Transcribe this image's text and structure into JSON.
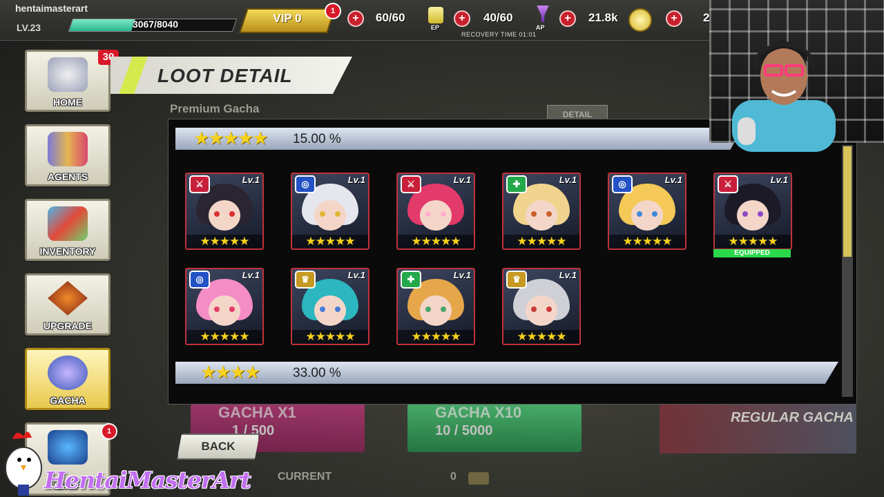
{
  "player": {
    "username": "hentaimasterart",
    "level": "LV.23",
    "exp": "3067/8040",
    "exp_fraction": 0.38
  },
  "vip": {
    "label": "VIP 0",
    "badge": "1"
  },
  "resources": {
    "ep": {
      "value": "60/60",
      "label": "EP"
    },
    "ap": {
      "value": "40/60",
      "label": "AP"
    },
    "gold": {
      "value": "21.8k"
    },
    "extra": {
      "value": "2"
    },
    "recovery": "RECOVERY TIME 01:01"
  },
  "sidebar": {
    "items": [
      {
        "label": "HOME",
        "badge": "30"
      },
      {
        "label": "AGENTS"
      },
      {
        "label": "INVENTORY"
      },
      {
        "label": "UPGRADE"
      },
      {
        "label": "GACHA"
      },
      {
        "label": "SHOP",
        "badge": "1"
      }
    ]
  },
  "page": {
    "title": "LOOT DETAIL",
    "subtitle": "Premium Gacha",
    "detail_button": "DETAIL",
    "back_button": "BACK",
    "current_label": "CURRENT",
    "current_value": "0",
    "gacha_x1": {
      "title": "GACHA X1",
      "cost": "1 / 500"
    },
    "gacha_x10": {
      "title": "GACHA X10",
      "cost": "10 / 5000"
    },
    "regular_gacha": "REGULAR GACHA"
  },
  "loot": {
    "tiers": [
      {
        "stars": "★★★★★",
        "percent": "15.00 %"
      },
      {
        "stars": "★★★★",
        "percent": "33.00 %"
      }
    ],
    "level_label": "Lv.1",
    "card_stars": "★★★★★",
    "equipped_label": "EQUIPPED",
    "cards": [
      {
        "class": "red",
        "hair": "#2a2530",
        "eye": "#d9302f"
      },
      {
        "class": "blue",
        "hair": "#e6e6ee",
        "eye": "#e2b631"
      },
      {
        "class": "red",
        "hair": "#e23a6a",
        "eye": "#ffb0c8"
      },
      {
        "class": "green",
        "hair": "#f0d48e",
        "eye": "#c9602a"
      },
      {
        "class": "blue",
        "hair": "#f4c958",
        "eye": "#3c8ad9"
      },
      {
        "class": "red",
        "hair": "#1c1a26",
        "eye": "#8f49c8",
        "equipped": true
      },
      {
        "class": "blue",
        "hair": "#f48cc6",
        "eye": "#e43d6a"
      },
      {
        "class": "gold",
        "hair": "#2bb6c0",
        "eye": "#4a7ad9"
      },
      {
        "class": "green",
        "hair": "#e6a64a",
        "eye": "#4aa66b"
      },
      {
        "class": "gold",
        "hair": "#cfd0d6",
        "eye": "#c93a3a"
      }
    ]
  },
  "colors": {
    "class_red": "#c8203a",
    "class_blue": "#2352c4",
    "class_green": "#23a84a",
    "class_gold": "#c69a22"
  },
  "watermark": "HentaiMasterArt"
}
